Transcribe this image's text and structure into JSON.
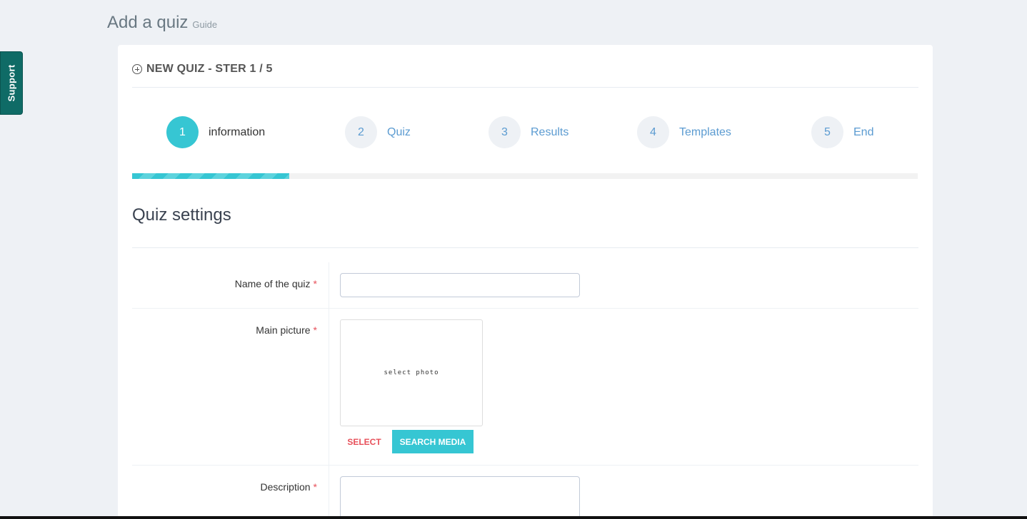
{
  "support": {
    "label": "Support"
  },
  "page": {
    "title": "Add a quiz",
    "subtitle": "Guide"
  },
  "portlet": {
    "caption": "NEW QUIZ - STER 1 / 5"
  },
  "steps": [
    {
      "num": "1",
      "label": "information",
      "active": true
    },
    {
      "num": "2",
      "label": "Quiz",
      "active": false
    },
    {
      "num": "3",
      "label": "Results",
      "active": false
    },
    {
      "num": "4",
      "label": "Templates",
      "active": false
    },
    {
      "num": "5",
      "label": "End",
      "active": false
    }
  ],
  "progress": {
    "fraction": 0.2
  },
  "section": {
    "title": "Quiz settings"
  },
  "form": {
    "name": {
      "label": "Name of the quiz",
      "required": "*",
      "value": "",
      "placeholder": ""
    },
    "picture": {
      "label": "Main picture",
      "required": "*",
      "placeholder": "select photo",
      "select_label": "SELECT",
      "search_label": "SEARCH MEDIA"
    },
    "description": {
      "label": "Description",
      "required": "*",
      "value": ""
    }
  },
  "colors": {
    "accent": "#36c6d3",
    "link": "#5b9bd1",
    "required": "#e7505a",
    "support": "#0f6b66"
  }
}
